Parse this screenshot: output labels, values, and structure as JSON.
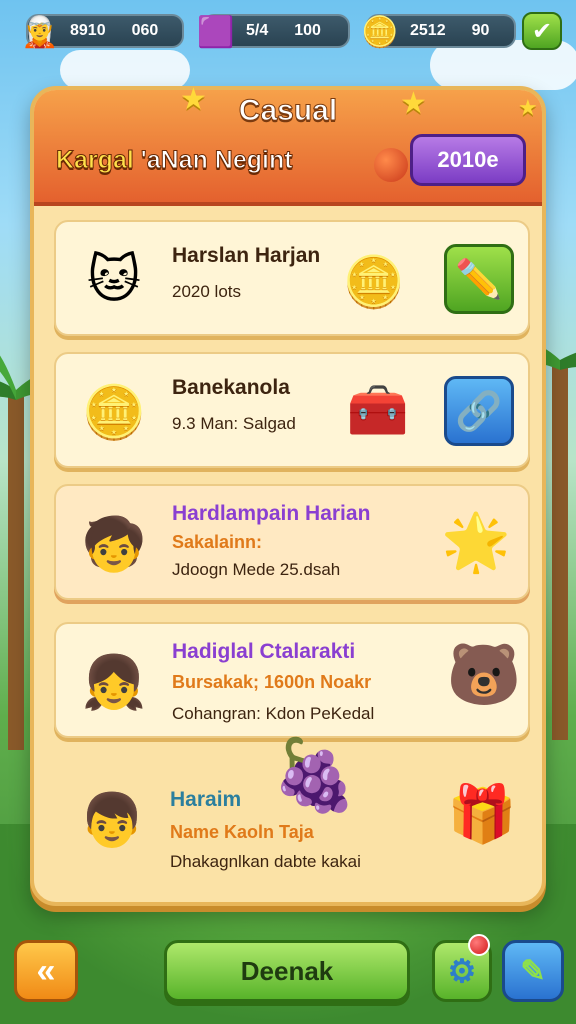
{
  "resources": [
    {
      "icon": "hero-icon",
      "value1": "8910",
      "value2": "060"
    },
    {
      "icon": "gem-icon",
      "value1": "5/4",
      "value2": "100"
    },
    {
      "icon": "coin-icon",
      "value1": "2512",
      "value2": "90"
    }
  ],
  "panel": {
    "title": "Casual",
    "subtitle_part1": "Kargal",
    "subtitle_part2": " 'aNan Negint",
    "pill_label": "2010e"
  },
  "items": [
    {
      "title": "Harslan Harjan",
      "line2": "2020 lots",
      "line3": ""
    },
    {
      "title": "Banekanola",
      "line2": "9.3 Man: Salgad",
      "line3": ""
    },
    {
      "title": "Hardlampain Harian",
      "line2": "Sakalainn:",
      "line3": "Jdoogn Mede 25.dsah"
    },
    {
      "title": "Hadiglal Ctalarakti",
      "line2": "Bursakak; 1600n Noakr",
      "line3": "Cohangran: Kdon PeKedal"
    },
    {
      "title": "Haraim",
      "line2": "Name Kaoln Taja",
      "line3": "Dhakagnlkan dabte kakai"
    }
  ],
  "bottom": {
    "back_label": "«",
    "main_label": "Deenak"
  },
  "colors": {
    "accent_orange": "#e4612e",
    "panel": "#fbe2a6",
    "purple": "#8a3fd1",
    "green": "#58b32a"
  }
}
